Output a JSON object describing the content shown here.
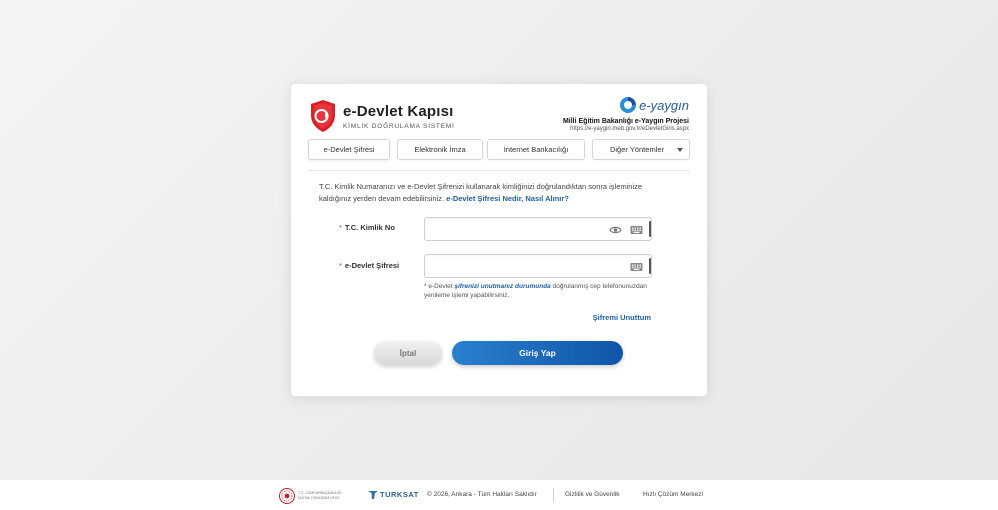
{
  "brand": {
    "title": "e-Devlet Kapısı",
    "subtitle": "KİMLİK DOĞRULAMA SİSTEMİ"
  },
  "partner": {
    "name": "e-yaygın",
    "project": "Milli Eğitim Bakanlığı e-Yaygın Projesi",
    "url": "https://e-yaygin.meb.gov.tr/eDevletGiris.aspx"
  },
  "tabs": [
    {
      "label": "e-Devlet Şifresi"
    },
    {
      "label": "Elektronik İmza"
    },
    {
      "label": "İnternet Bankacılığı"
    },
    {
      "label": "Diğer Yöntemler"
    }
  ],
  "intro": {
    "text": "T.C. Kimlik Numaranızı ve e-Devlet Şifrenizi kullanarak kimliğinizi doğrulandıktan sonra işleminize kaldığınız yerden devam edebilirsiniz.",
    "link": "e-Devlet Şifresi Nedir, Nasıl Alınır?"
  },
  "form": {
    "required_mark": "*",
    "tc_label": "T.C. Kimlik No",
    "password_label": "e-Devlet Şifresi",
    "tc_value": "",
    "password_value": "",
    "hint_prefix": "* e-Devlet",
    "hint_link": "şifrenizi unutmanız durumunda",
    "hint_suffix": "doğrulanmış cep telefonunuzdan yenileme işlemi yapabilirsiniz.",
    "forgot_label": "Şifremi Unuttum",
    "cancel_label": "İptal",
    "login_label": "Giriş Yap"
  },
  "footer": {
    "ministry": "T.C. CUMHURBAŞKANLIĞI DİJİTAL DÖNÜŞÜM OFİSİ",
    "turksat": "TURKSAT",
    "copyright": "© 2026, Ankara - Tüm Hakları Saklıdır",
    "privacy": "Gizlilik ve Güvenlik",
    "support": "Hızlı Çözüm Merkezi"
  },
  "colors": {
    "accent": "#1f5fa8",
    "shield_red": "#d8222a",
    "login_start": "#2a7fd0",
    "login_end": "#0f55a8"
  }
}
